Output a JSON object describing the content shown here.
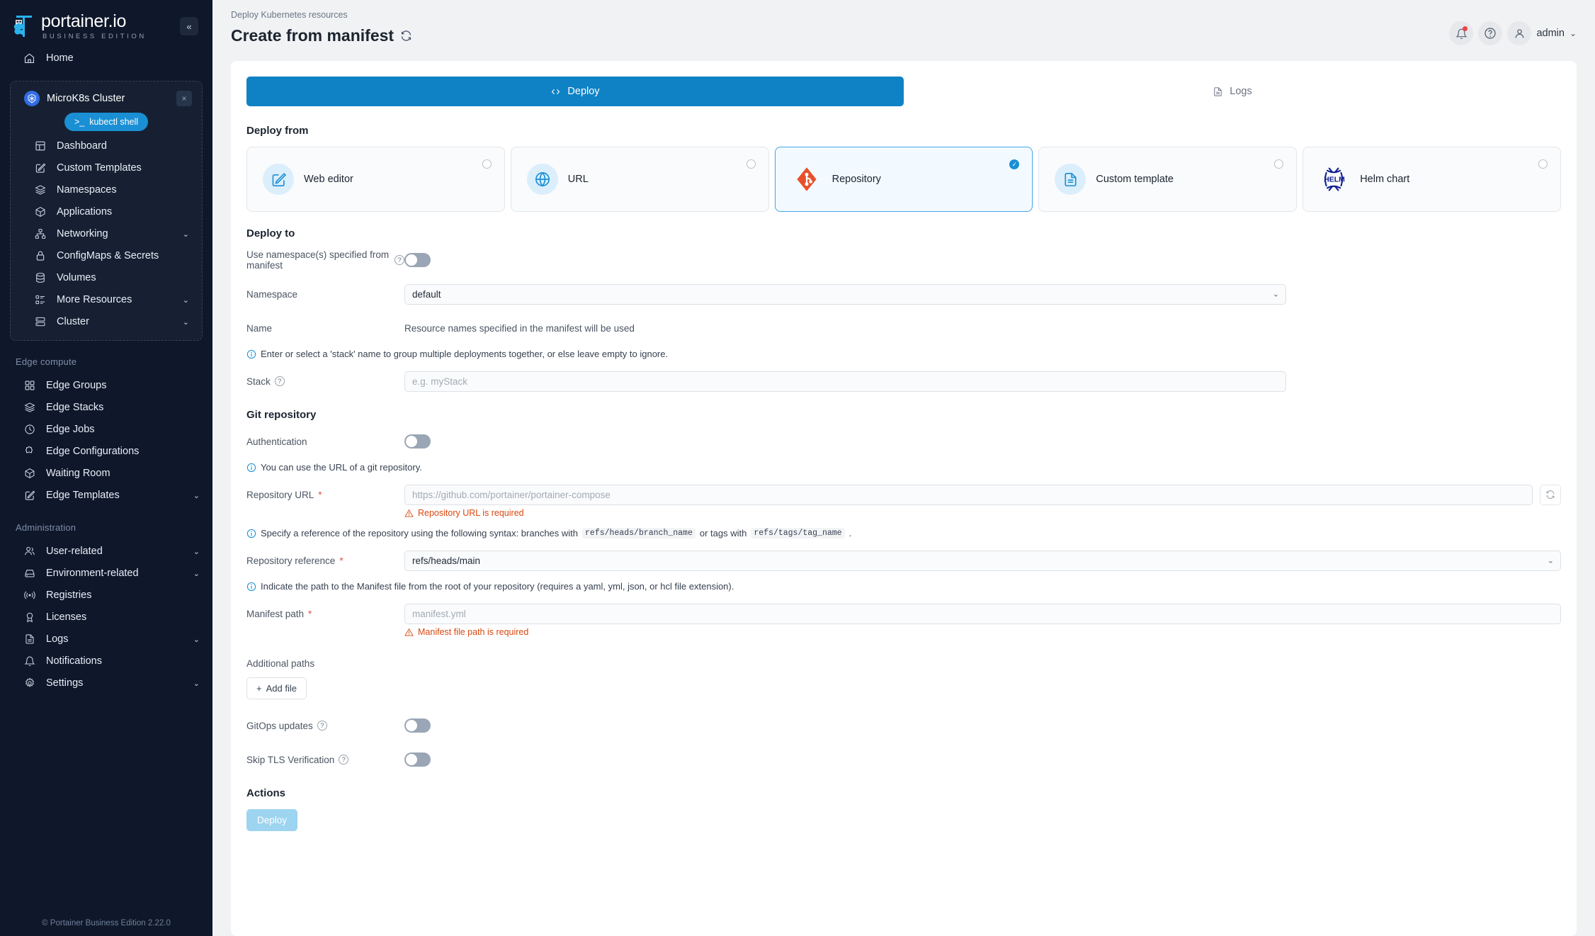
{
  "sidebar": {
    "logo": {
      "main": "portainer.io",
      "sub": "BUSINESS EDITION"
    },
    "collapse_label": "«",
    "home": {
      "label": "Home",
      "icon": "home-icon"
    },
    "environment": {
      "name": "MicroK8s Cluster",
      "close_label": "×",
      "kubectl_label": "kubectl shell",
      "kubectl_icon": ">_"
    },
    "env_items": [
      {
        "label": "Dashboard",
        "icon": "dashboard-icon",
        "chevron": false
      },
      {
        "label": "Custom Templates",
        "icon": "edit-square-icon",
        "chevron": false
      },
      {
        "label": "Namespaces",
        "icon": "layers-icon",
        "chevron": false
      },
      {
        "label": "Applications",
        "icon": "box-icon",
        "chevron": false
      },
      {
        "label": "Networking",
        "icon": "network-icon",
        "chevron": true
      },
      {
        "label": "ConfigMaps & Secrets",
        "icon": "lock-icon",
        "chevron": false
      },
      {
        "label": "Volumes",
        "icon": "database-icon",
        "chevron": false
      },
      {
        "label": "More Resources",
        "icon": "list-icon",
        "chevron": true
      },
      {
        "label": "Cluster",
        "icon": "server-icon",
        "chevron": true
      }
    ],
    "edge_section_title": "Edge compute",
    "edge_items": [
      {
        "label": "Edge Groups",
        "icon": "grid-icon",
        "chevron": false
      },
      {
        "label": "Edge Stacks",
        "icon": "layers-icon",
        "chevron": false
      },
      {
        "label": "Edge Jobs",
        "icon": "clock-icon",
        "chevron": false
      },
      {
        "label": "Edge Configurations",
        "icon": "puzzle-icon",
        "chevron": false
      },
      {
        "label": "Waiting Room",
        "icon": "box-icon",
        "chevron": false
      },
      {
        "label": "Edge Templates",
        "icon": "edit-square-icon",
        "chevron": true
      }
    ],
    "admin_section_title": "Administration",
    "admin_items": [
      {
        "label": "User-related",
        "icon": "users-icon",
        "chevron": true
      },
      {
        "label": "Environment-related",
        "icon": "hard-drive-icon",
        "chevron": true
      },
      {
        "label": "Registries",
        "icon": "radio-icon",
        "chevron": false
      },
      {
        "label": "Licenses",
        "icon": "award-icon",
        "chevron": false
      },
      {
        "label": "Logs",
        "icon": "file-text-icon",
        "chevron": true
      },
      {
        "label": "Notifications",
        "icon": "bell-icon",
        "chevron": false
      },
      {
        "label": "Settings",
        "icon": "gear-icon",
        "chevron": true
      }
    ],
    "footer": "© Portainer Business Edition  2.22.0"
  },
  "header": {
    "breadcrumb": "Deploy Kubernetes resources",
    "title": "Create from manifest",
    "user": "admin"
  },
  "tabs": [
    {
      "label": "Deploy",
      "icon": "code-icon",
      "active": true
    },
    {
      "label": "Logs",
      "icon": "file-text-icon",
      "active": false
    }
  ],
  "deploy_from": {
    "title": "Deploy from",
    "options": [
      {
        "label": "Web editor",
        "icon": "edit-square-icon",
        "selected": false
      },
      {
        "label": "URL",
        "icon": "globe-icon",
        "selected": false
      },
      {
        "label": "Repository",
        "icon": "git-icon",
        "selected": true
      },
      {
        "label": "Custom template",
        "icon": "file-icon",
        "selected": false
      },
      {
        "label": "Helm chart",
        "icon": "helm-icon",
        "selected": false
      }
    ]
  },
  "deploy_to": {
    "title": "Deploy to",
    "use_namespace_label": "Use namespace(s) specified from manifest",
    "use_namespace_on": false,
    "namespace_label": "Namespace",
    "namespace_value": "default",
    "name_label": "Name",
    "name_static": "Resource names specified in the manifest will be used",
    "stack_hint": "Enter or select a 'stack' name to group multiple deployments together, or else leave empty to ignore.",
    "stack_label": "Stack",
    "stack_placeholder": "e.g. myStack",
    "stack_value": ""
  },
  "git_repository": {
    "title": "Git repository",
    "authentication_label": "Authentication",
    "authentication_on": false,
    "url_hint": "You can use the URL of a git repository.",
    "url_label": "Repository URL",
    "url_placeholder": "https://github.com/portainer/portainer-compose",
    "url_value": "",
    "url_error": "Repository URL is required",
    "ref_hint_pre": "Specify a reference of the repository using the following syntax: branches with",
    "ref_hint_code1": "refs/heads/branch_name",
    "ref_hint_mid": "or tags with",
    "ref_hint_code2": "refs/tags/tag_name",
    "ref_hint_post": ".",
    "ref_label": "Repository reference",
    "ref_value": "refs/heads/main",
    "manifest_hint": "Indicate the path to the Manifest file from the root of your repository (requires a yaml, yml, json, or hcl file extension).",
    "manifest_label": "Manifest path",
    "manifest_placeholder": "manifest.yml",
    "manifest_value": "",
    "manifest_error": "Manifest file path is required",
    "additional_paths_label": "Additional paths",
    "add_file_label": "Add file",
    "gitops_label": "GitOps updates",
    "gitops_on": false,
    "skip_tls_label": "Skip TLS Verification",
    "skip_tls_on": false
  },
  "actions": {
    "title": "Actions",
    "deploy_label": "Deploy"
  },
  "colors": {
    "accent": "#0f82c5",
    "sidebar_bg": "#0f172a",
    "error": "#d9480f",
    "git_orange": "#e8502c"
  }
}
